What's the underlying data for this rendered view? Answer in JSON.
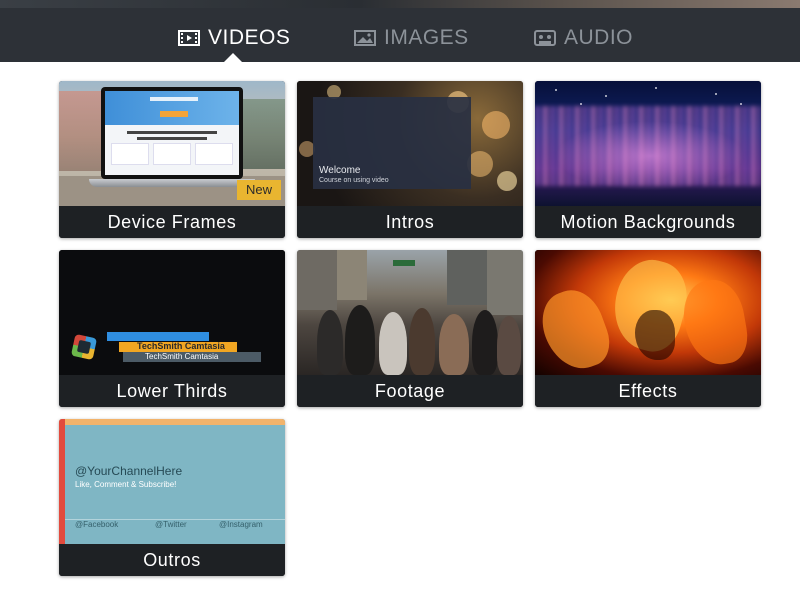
{
  "tabs": [
    {
      "label": "VIDEOS",
      "icon": "film-icon",
      "active": true
    },
    {
      "label": "IMAGES",
      "icon": "image-icon",
      "active": false
    },
    {
      "label": "AUDIO",
      "icon": "cassette-icon",
      "active": false
    }
  ],
  "cards": [
    {
      "label": "Device Frames",
      "badge": "New"
    },
    {
      "label": "Intros",
      "thumb_title": "Welcome",
      "thumb_subtitle": "Course on using video"
    },
    {
      "label": "Motion Backgrounds"
    },
    {
      "label": "Lower Thirds",
      "thumb_line1": "TechSmith Camtasia",
      "thumb_line2": "TechSmith Camtasia"
    },
    {
      "label": "Footage"
    },
    {
      "label": "Effects"
    },
    {
      "label": "Outros",
      "thumb_handle": "@YourChannelHere",
      "thumb_cta": "Like, Comment & Subscribe!",
      "thumb_social": [
        "@Facebook",
        "@Twitter",
        "@Instagram"
      ]
    }
  ],
  "colors": {
    "navbar": "#2d3137",
    "tab_active": "#ffffff",
    "tab_inactive": "#8c9299",
    "card_label_bg": "#1e2124",
    "badge": "#e9b530"
  }
}
